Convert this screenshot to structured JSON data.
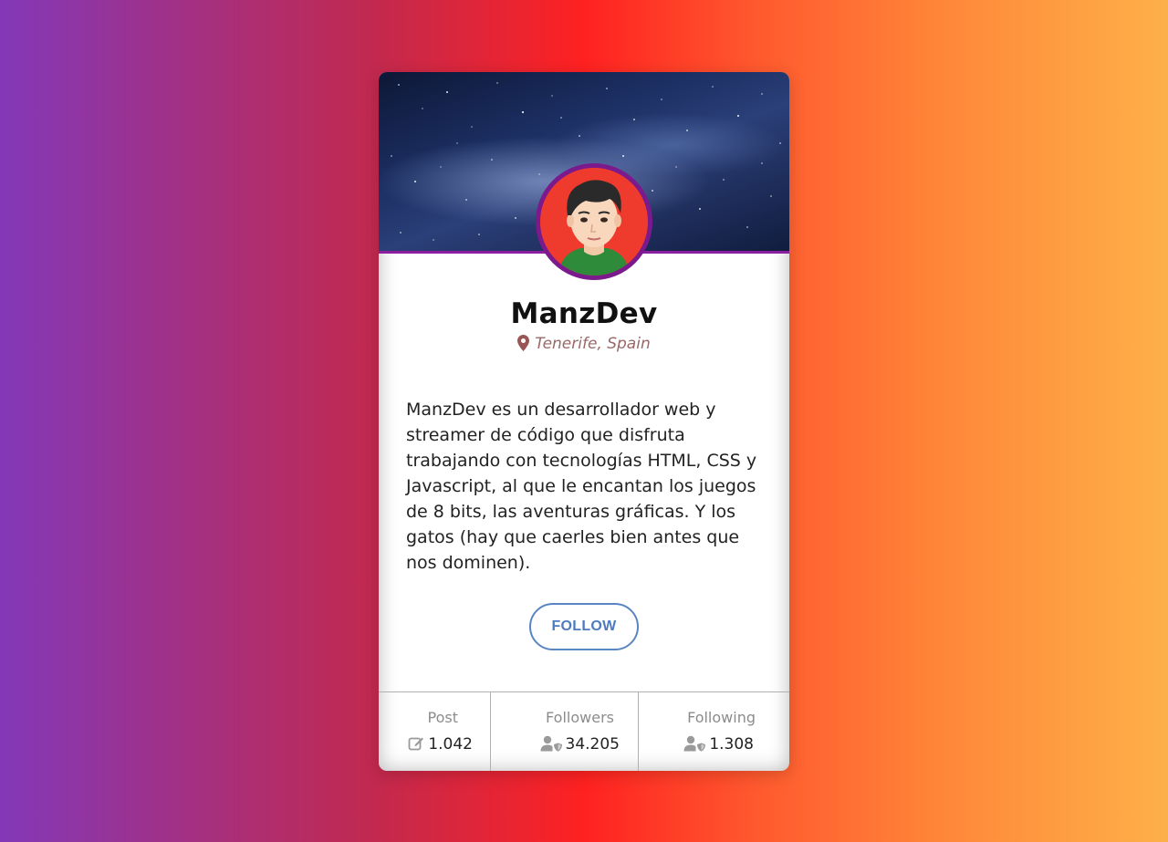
{
  "profile": {
    "name": "ManzDev",
    "location": "Tenerife, Spain",
    "bio": "ManzDev es un desarrollador web y streamer de código que disfruta trabajando con tecnologías HTML, CSS y Javascript, al que le encantan los juegos de 8 bits, las aventuras gráficas. Y los gatos (hay que caerles bien antes que nos dominen).",
    "follow_label": "FOLLOW"
  },
  "stats": [
    {
      "label": "Post",
      "value": "1.042",
      "icon": "edit-icon"
    },
    {
      "label": "Followers",
      "value": "34.205",
      "icon": "user-shield-icon"
    },
    {
      "label": "Following",
      "value": "1.308",
      "icon": "user-shield-icon"
    }
  ],
  "colors": {
    "avatar_border": "#7b1a8d",
    "avatar_bg": "#ef3b2d",
    "follow_accent": "#4c7bc0",
    "location_text": "#9a6868"
  },
  "icons": {
    "location": "map-marker-icon"
  }
}
